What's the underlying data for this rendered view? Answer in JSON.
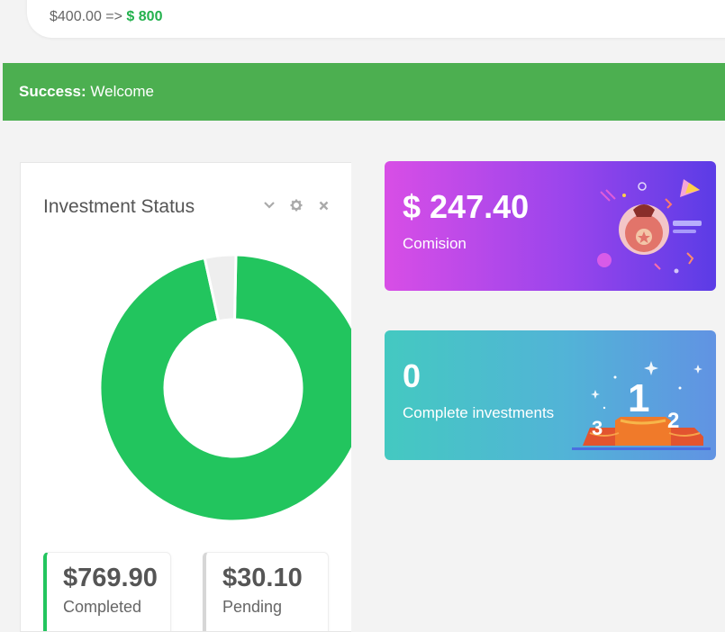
{
  "summary": {
    "from": "$400.00 =>",
    "to": "$ 800"
  },
  "alert": {
    "label": "Success:",
    "message": "Welcome"
  },
  "investment_status": {
    "title": "Investment Status",
    "tools": [
      "chevron-down-icon",
      "gear-icon",
      "close-icon"
    ],
    "completed_value": "$769.90",
    "completed_label": "Completed",
    "pending_value": "$30.10",
    "pending_label": "Pending",
    "completed_amount": 769.9,
    "pending_amount": 30.1,
    "completed_color": "#22c55e",
    "pending_color": "#eeeeee"
  },
  "cards": {
    "commission_value": "$ 247.40",
    "commission_label": "Comision",
    "investments_value": "0",
    "investments_label": "Complete investments"
  },
  "colors": {
    "success": "#4caf50",
    "accent_green": "#23b14d"
  }
}
